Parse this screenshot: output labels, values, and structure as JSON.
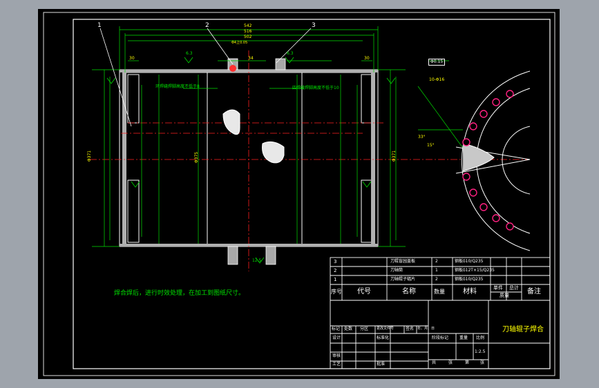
{
  "drawing": {
    "title": "刀轴辊子焊合",
    "note": "焊合焊后，进行时效处理，在加工到图纸尺寸。",
    "callouts": [
      "1",
      "2",
      "3"
    ],
    "dimensions": {
      "top_overall": "542",
      "top_2": "516",
      "top_3": "502",
      "top_left_30": "30",
      "top_right_30": "30",
      "top_center": "34",
      "tol_small": "Φ4上0.05",
      "ground_symbol_1": "6.3",
      "ground_symbol_2": "6.3",
      "left_dia": "Φ371",
      "right_dia": "Φ371",
      "center_dia": "Φ375",
      "bottom_sym": "12.5",
      "angle_a": "33°",
      "angle_b": "15°",
      "hole_spec": "10-Φ16",
      "tolerance_box": "Φ0.15"
    },
    "weld_notes": {
      "left": "环焊缝焊脚高度不低于8",
      "right": "四焊缝焊脚高度不低于10"
    }
  },
  "bom": {
    "rows": [
      {
        "no": "3",
        "code": "",
        "name": "刀辊盲园盖板",
        "qty": "2",
        "material": "钢板δ10/Q235"
      },
      {
        "no": "2",
        "code": "",
        "name": "刀轴筒",
        "qty": "1",
        "material": "钢板δ12T×15/Q235"
      },
      {
        "no": "1",
        "code": "",
        "name": "刀轴辊子辐片",
        "qty": "2",
        "material": "钢板δ10/Q235"
      }
    ],
    "header": {
      "no": "序号",
      "code": "代号",
      "name": "名称",
      "qty": "数量",
      "material": "材料",
      "unit_w": "单件",
      "total_w": "总计",
      "weight": "质量",
      "remark": "备注"
    }
  },
  "titleblock": {
    "rev_labels": [
      "标记",
      "处数",
      "分区",
      "更改文件号",
      "签名",
      "年、月、日"
    ],
    "design": "设计",
    "std": "标准化",
    "review": "审核",
    "process": "工艺",
    "approve": "批准",
    "stage": "阶段标记",
    "mass": "重量",
    "scale_label": "比例",
    "scale": "1:2.5",
    "sheets_a": "共",
    "sheets_b": "张",
    "sheets_c": "第",
    "sheets_d": "张"
  }
}
